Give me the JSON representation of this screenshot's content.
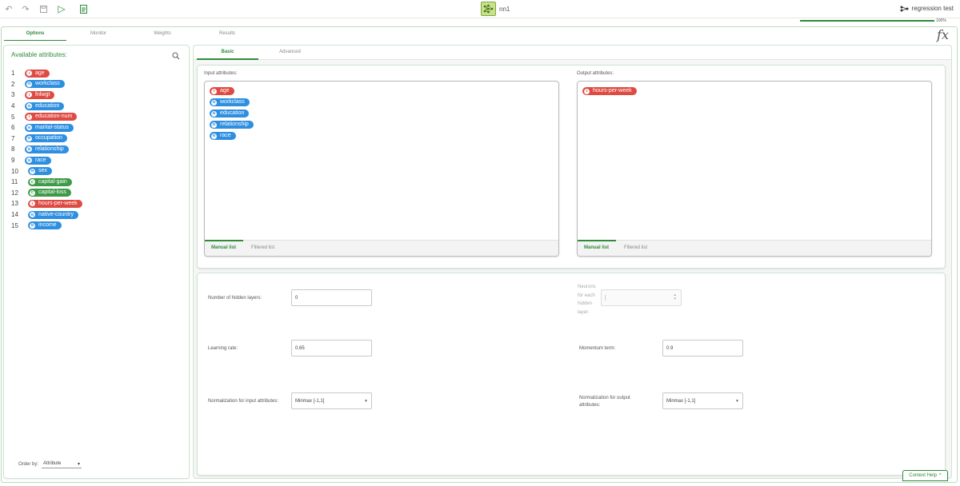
{
  "toolbar": {
    "task_name": "nn1",
    "project_name": "regression test"
  },
  "progress": {
    "percent_label": "100%",
    "value": 1.0
  },
  "main_tabs": [
    "Options",
    "Monitor",
    "Weights",
    "Results"
  ],
  "fx_label": "fx",
  "left_panel": {
    "title": "Available attributes:",
    "attributes": [
      {
        "num": "1",
        "type": "I",
        "name": "age"
      },
      {
        "num": "2",
        "type": "N",
        "name": "workclass"
      },
      {
        "num": "3",
        "type": "I",
        "name": "fnlwgt"
      },
      {
        "num": "4",
        "type": "N",
        "name": "education"
      },
      {
        "num": "5",
        "type": "I",
        "name": "education-num"
      },
      {
        "num": "6",
        "type": "N",
        "name": "marital-status"
      },
      {
        "num": "7",
        "type": "N",
        "name": "occupation"
      },
      {
        "num": "8",
        "type": "N",
        "name": "relationship"
      },
      {
        "num": "9",
        "type": "N",
        "name": "race"
      },
      {
        "num": "10",
        "type": "N",
        "name": "sex"
      },
      {
        "num": "11",
        "type": "C",
        "name": "capital-gain"
      },
      {
        "num": "12",
        "type": "C",
        "name": "capital-loss"
      },
      {
        "num": "13",
        "type": "I",
        "name": "hours-per-week"
      },
      {
        "num": "14",
        "type": "N",
        "name": "native-country"
      },
      {
        "num": "15",
        "type": "N",
        "name": "income"
      }
    ],
    "order_by_label": "Order by:",
    "order_by_value": "Attribute"
  },
  "sub_tabs": [
    "Basic",
    "Advanced"
  ],
  "input_attributes": {
    "label": "Input attributes:",
    "items": [
      {
        "type": "I",
        "name": "age"
      },
      {
        "type": "N",
        "name": "workclass"
      },
      {
        "type": "N",
        "name": "education"
      },
      {
        "type": "N",
        "name": "relationship"
      },
      {
        "type": "N",
        "name": "race"
      }
    ],
    "tabs": [
      "Manual list",
      "Filtered list"
    ]
  },
  "output_attributes": {
    "label": "Output attributes:",
    "items": [
      {
        "type": "I",
        "name": "hours-per-week"
      }
    ],
    "tabs": [
      "Manual list",
      "Filtered list"
    ]
  },
  "params": {
    "hidden_layers_label": "Number of hidden layers:",
    "hidden_layers_value": "0",
    "neurons_label": [
      "Neurons",
      "for each",
      "hidden",
      "layer:"
    ],
    "neurons_value": "[",
    "learning_rate_label": "Learning rate:",
    "learning_rate_value": "0.65",
    "momentum_label": "Momentum term:",
    "momentum_value": "0.9",
    "norm_input_label": "Normalization for input attributes:",
    "norm_input_value": "Minmax [-1,1]",
    "norm_output_label": [
      "Normalization for output",
      "attributes:"
    ],
    "norm_output_value": "Minmax [-1,1]"
  },
  "context_help": "Context Help",
  "colors": {
    "accent": "#2e8b3a",
    "integer": "#de4b43",
    "nominal": "#2e8fe0",
    "continuous": "#3d9a46"
  }
}
